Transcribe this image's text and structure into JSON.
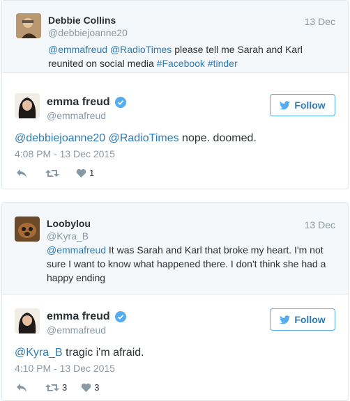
{
  "thread1": {
    "parent": {
      "name": "Debbie Collins",
      "handle": "@debbiejoanne20",
      "date": "13 Dec",
      "text_m1": "@emmafreud",
      "text_m2": "@RadioTimes",
      "text_a": " please tell me Sarah and Karl reunited on social media ",
      "text_h1": "#Facebook",
      "text_h2": "#tinder"
    },
    "reply": {
      "name": "emma freud",
      "handle": "@emmafreud",
      "follow_label": "Follow",
      "text_m1": "@debbiejoanne20",
      "text_m2": "@RadioTimes",
      "text_a": " nope.  doomed.",
      "time": "4:08 PM - 13 Dec 2015",
      "retweets": "",
      "likes": "1"
    }
  },
  "thread2": {
    "parent": {
      "name": "Loobylou",
      "handle": "@Kyra_B",
      "date": "13 Dec",
      "text_m1": "@emmafreud",
      "text_a": " It was Sarah and Karl that broke my heart. I'm not sure I want to know what happened there. I don't think she had a happy ending"
    },
    "reply": {
      "name": "emma freud",
      "handle": "@emmafreud",
      "follow_label": "Follow",
      "text_m1": "@Kyra_B",
      "text_a": " tragic i'm afraid.",
      "time": "4:10 PM - 13 Dec 2015",
      "retweets": "3",
      "likes": "3"
    }
  },
  "colors": {
    "link": "#2b7bb9",
    "muted": "#8899a6",
    "parent_bg": "#f5f8fa",
    "border": "#e1e8ed",
    "verified": "#55acee"
  },
  "icons": [
    "reply-icon",
    "retweet-icon",
    "like-icon",
    "verified-badge-icon",
    "twitter-bird-icon"
  ]
}
